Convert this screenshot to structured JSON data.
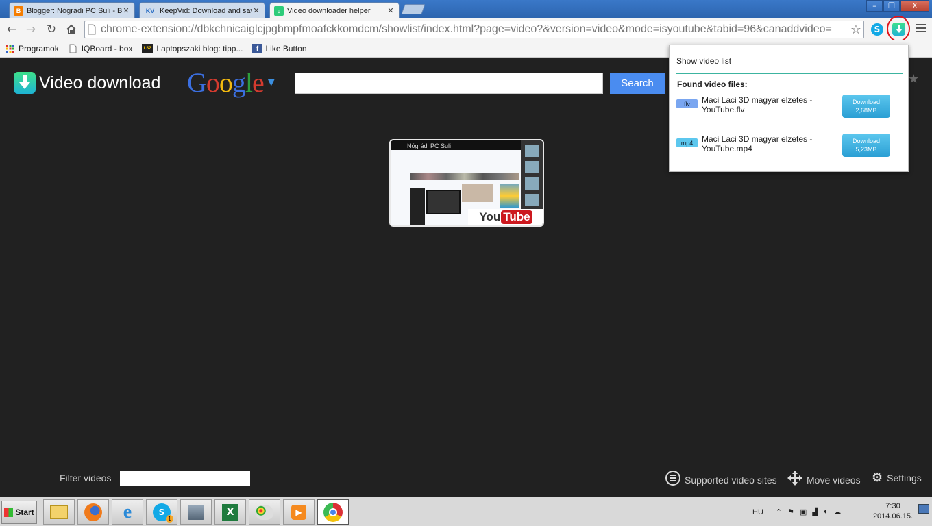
{
  "tabs": [
    {
      "label": "Blogger: Nógrádi PC Suli - Be",
      "icon": "blogger-icon",
      "color": "#f57d00"
    },
    {
      "label": "KeepVid: Download and save",
      "icon": "keepvid-icon",
      "badge": "KV",
      "color": "#2a6ec4"
    },
    {
      "label": "Video downloader helper",
      "icon": "video-downloader-icon",
      "color": "#2dcc7a",
      "active": true
    }
  ],
  "window": {
    "minimize": "–",
    "restore": "❐",
    "close": "X"
  },
  "address": {
    "url": "chrome-extension://dbkchnicaiglcjpgbmpfmoafckkomdcm/showlist/index.html?page=video?&version=video&mode=isyoutube&tabid=96&canaddvideo="
  },
  "bookmarks": [
    {
      "label": "Programok",
      "icon": "apps-grid-icon"
    },
    {
      "label": "IQBoard - box",
      "icon": "page-icon"
    },
    {
      "label": "Laptopszaki blog: tipp...",
      "icon": "lsz-icon",
      "badge": "LSZ"
    },
    {
      "label": "Like Button",
      "icon": "facebook-icon",
      "badge": "f"
    }
  ],
  "header": {
    "app_title": "Video download",
    "google": [
      "G",
      "o",
      "o",
      "g",
      "l",
      "e"
    ],
    "google_colors": [
      "#3b6fe0",
      "#d43b2f",
      "#f2b90f",
      "#3b6fe0",
      "#2e9e3d",
      "#d43b2f"
    ],
    "search_value": "",
    "search_button": "Search"
  },
  "thumbnail": {
    "brand_you": "You",
    "brand_tube": "Tube",
    "page_title": "Nógrádi PC Suli"
  },
  "popup": {
    "title": "Show video list",
    "found_label": "Found video files:",
    "videos": [
      {
        "format": "flv",
        "name": "Maci Laci 3D magyar elzetes - YouTube.flv",
        "button": "Download",
        "size": "2,68MB",
        "badge_color": "#7aa6f0"
      },
      {
        "format": "mp4",
        "name": "Maci Laci 3D magyar elzetes - YouTube.mp4",
        "button": "Download",
        "size": "5,23MB",
        "badge_color": "#5cc7ee"
      }
    ]
  },
  "footer": {
    "filter_label": "Filter videos",
    "filter_value": "",
    "links": [
      {
        "label": "Supported video sites",
        "icon": "list-icon"
      },
      {
        "label": "Move videos",
        "icon": "move-icon"
      },
      {
        "label": "Settings",
        "icon": "gear-icon"
      }
    ]
  },
  "taskbar": {
    "start": "Start",
    "apps": [
      "explorer-icon",
      "firefox-icon",
      "internet-explorer-icon",
      "skype-icon",
      "movie-maker-icon",
      "excel-icon",
      "paint-icon",
      "media-player-icon",
      "chrome-icon"
    ],
    "skype_badge": "1",
    "lang": "HU",
    "time": "7:30",
    "date": "2014.06.15."
  }
}
